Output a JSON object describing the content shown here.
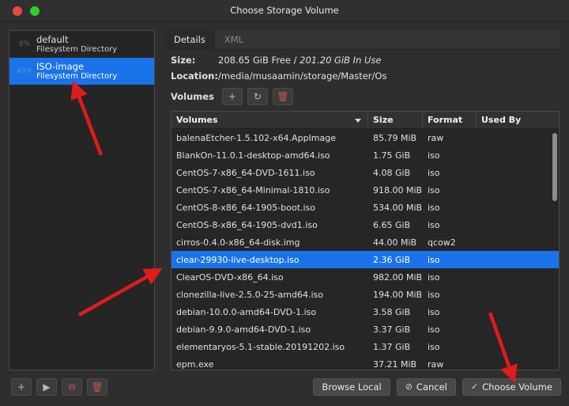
{
  "window": {
    "title": "Choose Storage Volume",
    "close_label": "",
    "maximize_label": ""
  },
  "sidebar": {
    "pools": [
      {
        "percent": "8%",
        "name": "default",
        "type": "Filesystem Directory",
        "selected": false
      },
      {
        "percent": "49%",
        "name": "ISO-image",
        "type": "Filesystem Directory",
        "selected": true
      }
    ],
    "toolbar": [
      {
        "name": "add-pool-button",
        "glyph": "+",
        "danger": false
      },
      {
        "name": "start-pool-button",
        "glyph": "▶",
        "danger": false
      },
      {
        "name": "stop-pool-button",
        "glyph": "⊖",
        "danger": true
      },
      {
        "name": "delete-pool-button",
        "glyph": "🗑",
        "danger": true
      }
    ]
  },
  "details": {
    "tabs": [
      {
        "label": "Details",
        "active": true
      },
      {
        "label": "XML",
        "active": false
      }
    ],
    "size_label": "Size:",
    "size_free": "208.65 GiB Free",
    "size_sep": " / ",
    "size_used": "201.20 GiB In Use",
    "location_label": "Location:",
    "location_value": "/media/musaamin/storage/Master/Os",
    "volumes_label": "Volumes",
    "volume_toolbar": [
      {
        "name": "create-volume-button",
        "glyph": "+",
        "danger": false
      },
      {
        "name": "refresh-volumes-button",
        "glyph": "↻",
        "danger": false
      },
      {
        "name": "delete-volume-button",
        "glyph": "🗑",
        "danger": true
      }
    ]
  },
  "table": {
    "columns": [
      "Volumes",
      "Size",
      "Format",
      "Used By"
    ],
    "sorted_column": "Volumes",
    "rows": [
      {
        "volume": "balenaEtcher-1.5.102-x64.AppImage",
        "size": "85.79 MiB",
        "format": "raw",
        "used_by": "",
        "selected": false
      },
      {
        "volume": "BlankOn-11.0.1-desktop-amd64.iso",
        "size": "1.75 GiB",
        "format": "iso",
        "used_by": "",
        "selected": false
      },
      {
        "volume": "CentOS-7-x86_64-DVD-1611.iso",
        "size": "4.08 GiB",
        "format": "iso",
        "used_by": "",
        "selected": false
      },
      {
        "volume": "CentOS-7-x86_64-Minimal-1810.iso",
        "size": "918.00 MiB",
        "format": "iso",
        "used_by": "",
        "selected": false
      },
      {
        "volume": "CentOS-8-x86_64-1905-boot.iso",
        "size": "534.00 MiB",
        "format": "iso",
        "used_by": "",
        "selected": false
      },
      {
        "volume": "CentOS-8-x86_64-1905-dvd1.iso",
        "size": "6.65 GiB",
        "format": "iso",
        "used_by": "",
        "selected": false
      },
      {
        "volume": "cirros-0.4.0-x86_64-disk.img",
        "size": "44.00 MiB",
        "format": "qcow2",
        "used_by": "",
        "selected": false
      },
      {
        "volume": "clear-29930-live-desktop.iso",
        "size": "2.36 GiB",
        "format": "iso",
        "used_by": "",
        "selected": true
      },
      {
        "volume": "ClearOS-DVD-x86_64.iso",
        "size": "982.00 MiB",
        "format": "iso",
        "used_by": "",
        "selected": false
      },
      {
        "volume": "clonezilla-live-2.5.0-25-amd64.iso",
        "size": "194.00 MiB",
        "format": "iso",
        "used_by": "",
        "selected": false
      },
      {
        "volume": "debian-10.0.0-amd64-DVD-1.iso",
        "size": "3.58 GiB",
        "format": "iso",
        "used_by": "",
        "selected": false
      },
      {
        "volume": "debian-9.9.0-amd64-DVD-1.iso",
        "size": "3.37 GiB",
        "format": "iso",
        "used_by": "",
        "selected": false
      },
      {
        "volume": "elementaryos-5.1-stable.20191202.iso",
        "size": "1.37 GiB",
        "format": "iso",
        "used_by": "",
        "selected": false
      },
      {
        "volume": "epm.exe",
        "size": "37.21 MiB",
        "format": "raw",
        "used_by": "",
        "selected": false
      }
    ]
  },
  "footer": {
    "browse_local": "Browse Local",
    "cancel": "Cancel",
    "cancel_glyph": "⊘",
    "choose_volume": "Choose Volume",
    "choose_glyph": "✓"
  },
  "colors": {
    "accent": "#1a73e8",
    "annotation": "#e01b1b",
    "window_bg": "#2e2e2e",
    "close_btn": "#e8483f",
    "max_btn": "#2ed12e"
  }
}
